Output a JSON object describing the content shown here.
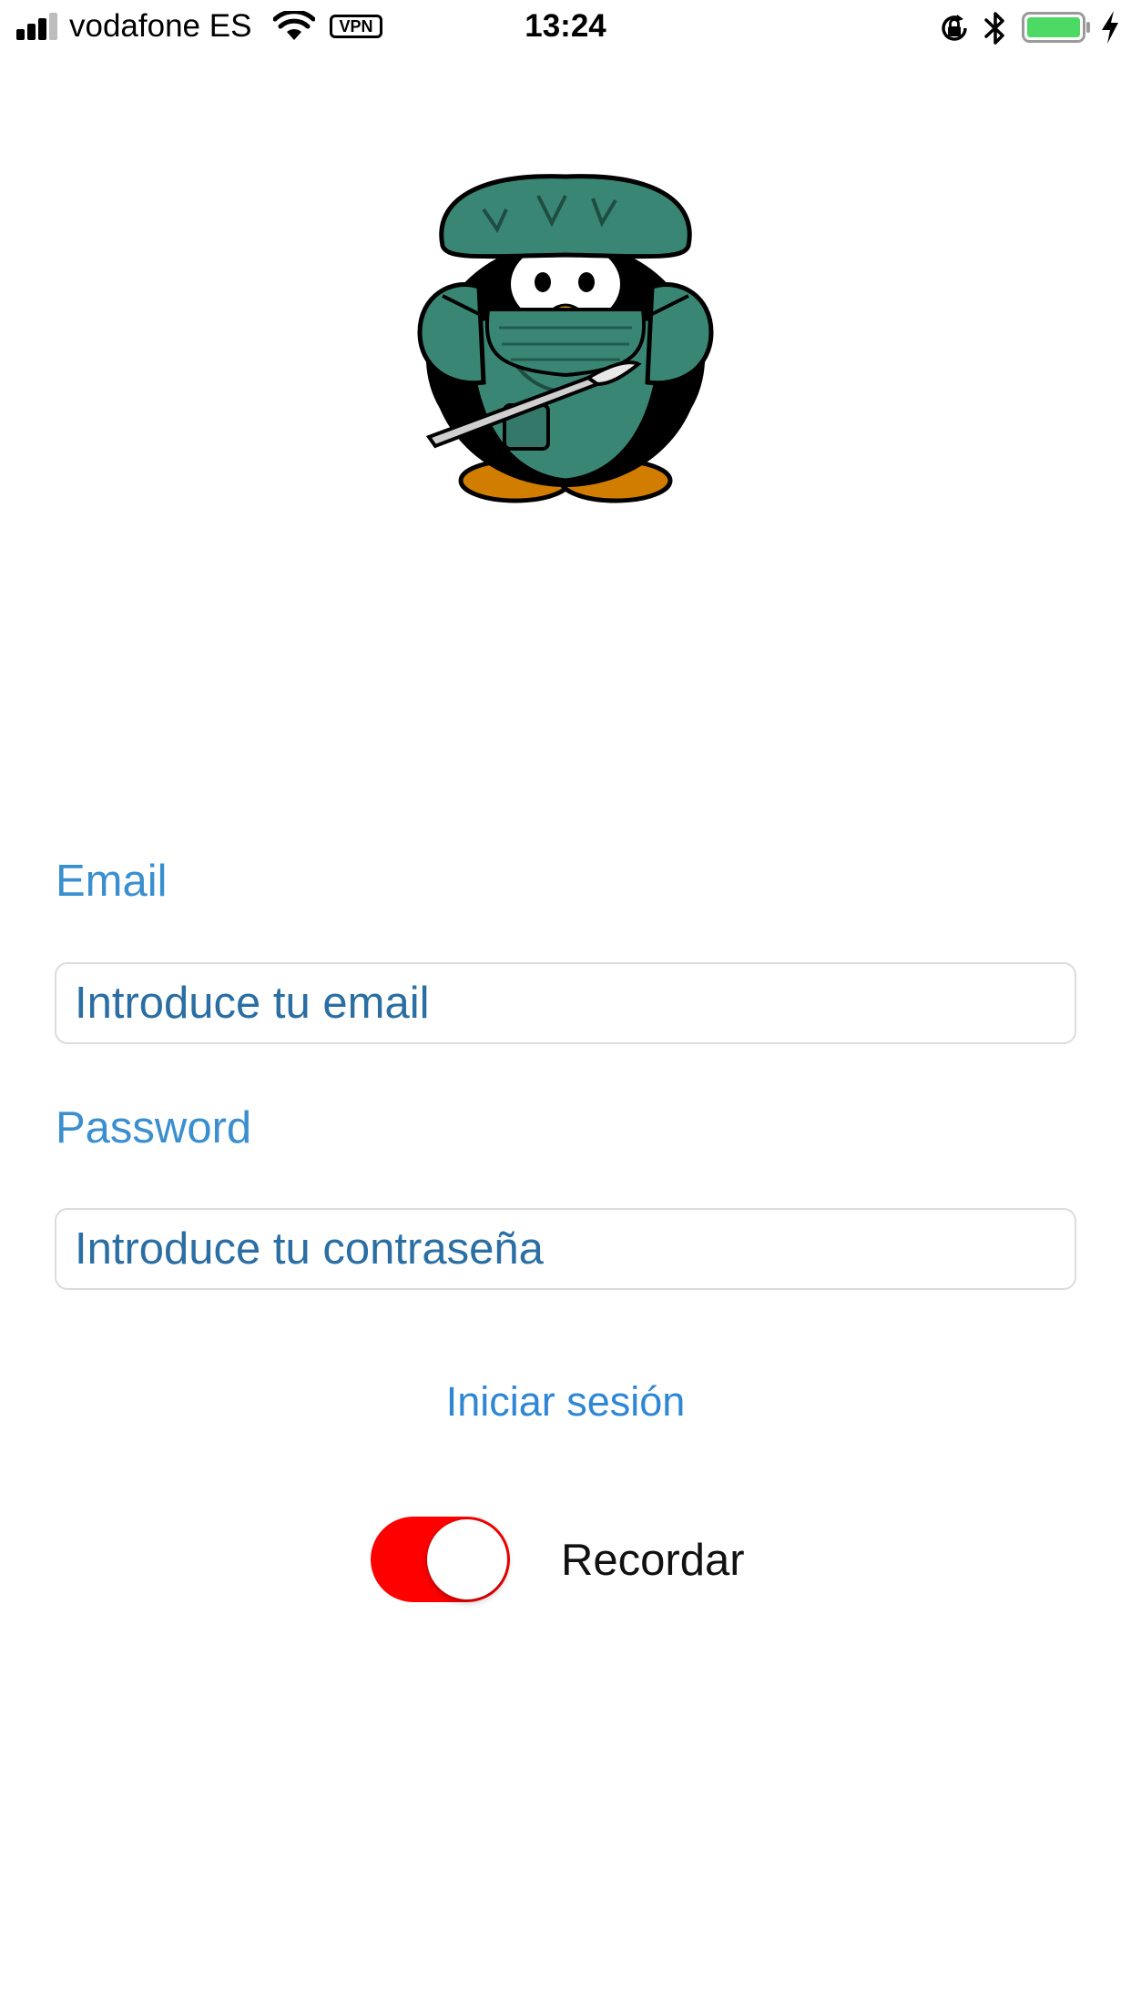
{
  "status_bar": {
    "carrier": "vodafone ES",
    "vpn": "VPN",
    "time": "13:24",
    "battery_color": "#4cd964"
  },
  "logo": {
    "icon": "surgeon-penguin-icon"
  },
  "form": {
    "email_label": "Email",
    "email_placeholder": "Introduce tu email",
    "password_label": "Password",
    "password_placeholder": "Introduce tu contraseña",
    "login_label": "Iniciar sesión",
    "remember_label": "Recordar",
    "remember_on": true
  },
  "colors": {
    "label": "#3a8fd0",
    "link": "#2f87d4",
    "toggle_on": "#ff0000"
  }
}
